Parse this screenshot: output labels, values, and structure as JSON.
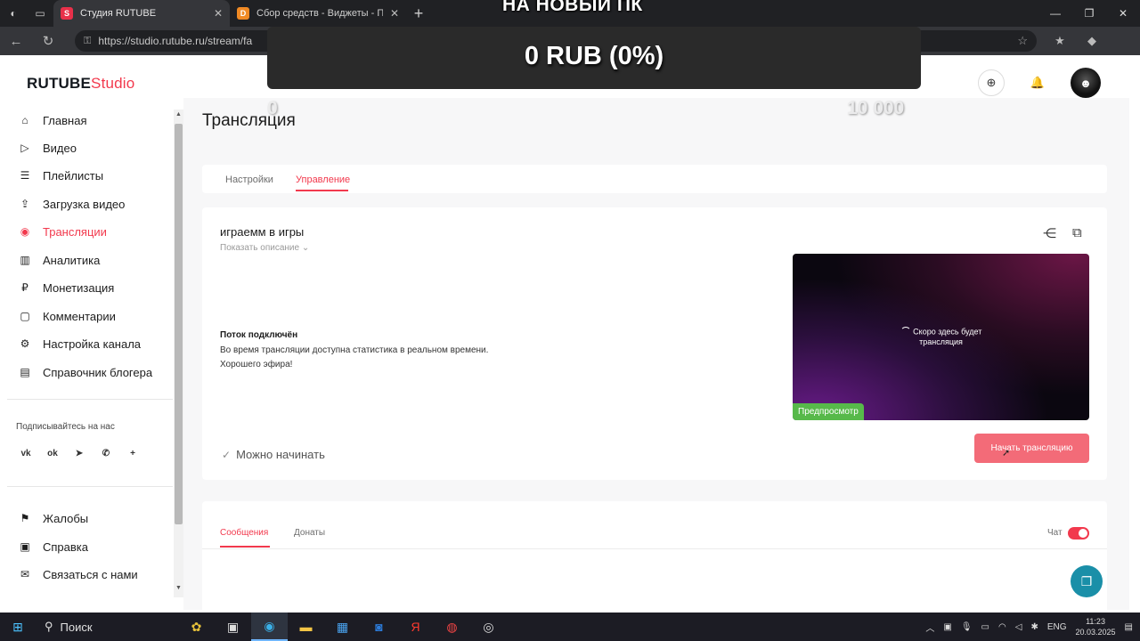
{
  "browser": {
    "tabs": [
      {
        "title": "Студия RUTUBE",
        "favicon": "S",
        "favicon_color": "#e8304a",
        "active": true
      },
      {
        "title": "Сбор средств - Виджеты - Пане",
        "favicon": "D",
        "favicon_color": "#f08a24",
        "active": false
      }
    ],
    "url": "https://studio.rutube.ru/stream/fa"
  },
  "app": {
    "logo_main": "RUTUBE",
    "logo_sub": "Studio",
    "accent_color": "#f2394d"
  },
  "sidebar": {
    "items": [
      {
        "label": "Главная",
        "icon": "home-icon",
        "active": false
      },
      {
        "label": "Видео",
        "icon": "video-icon",
        "active": false
      },
      {
        "label": "Плейлисты",
        "icon": "playlist-icon",
        "active": false
      },
      {
        "label": "Загрузка видео",
        "icon": "upload-icon",
        "active": false
      },
      {
        "label": "Трансляции",
        "icon": "broadcast-icon",
        "active": true
      },
      {
        "label": "Аналитика",
        "icon": "analytics-icon",
        "active": false
      },
      {
        "label": "Монетизация",
        "icon": "ruble-icon",
        "active": false
      },
      {
        "label": "Комментарии",
        "icon": "comment-icon",
        "active": false
      },
      {
        "label": "Настройка канала",
        "icon": "channel-settings-icon",
        "active": false
      },
      {
        "label": "Справочник блогера",
        "icon": "book-icon",
        "active": false
      }
    ],
    "subscribe_label": "Подписывайтесь на нас",
    "socials": [
      "vk-icon",
      "ok-icon",
      "telegram-icon",
      "viber-icon",
      "plus-icon"
    ],
    "bottom_items": [
      {
        "label": "Жалобы",
        "icon": "flag-icon"
      },
      {
        "label": "Справка",
        "icon": "help-icon"
      },
      {
        "label": "Связаться с нами",
        "icon": "mail-icon"
      }
    ]
  },
  "page": {
    "title": "Трансляция",
    "tabs": [
      "Настройки",
      "Управление"
    ],
    "active_tab": "Управление"
  },
  "stream": {
    "title": "играемм в игры",
    "show_description": "Показать описание",
    "status_title": "Поток подключён",
    "status_text1": "Во время трансляции доступна статистика в реальном времени.",
    "status_text2": "Хорошего эфира!",
    "ready_label": "Можно начинать",
    "preview_text_line1": "Скоро здесь будет",
    "preview_text_line2": "трансляция",
    "preview_badge": "Предпросмотр",
    "start_button": "Начать трансляцию"
  },
  "chat": {
    "tabs": [
      "Сообщения",
      "Донаты"
    ],
    "active_tab": "Сообщения",
    "toggle_label": "Чат",
    "toggle_on": true
  },
  "overlay": {
    "heading": "НА НОВЫЙ ПК",
    "amount": "0 RUB (0%)",
    "min": "0",
    "max": "10 000",
    "progress_percent": 0
  },
  "taskbar": {
    "search_label": "Поиск",
    "lang": "ENG",
    "time": "11:23",
    "date": "20.03.2025"
  }
}
